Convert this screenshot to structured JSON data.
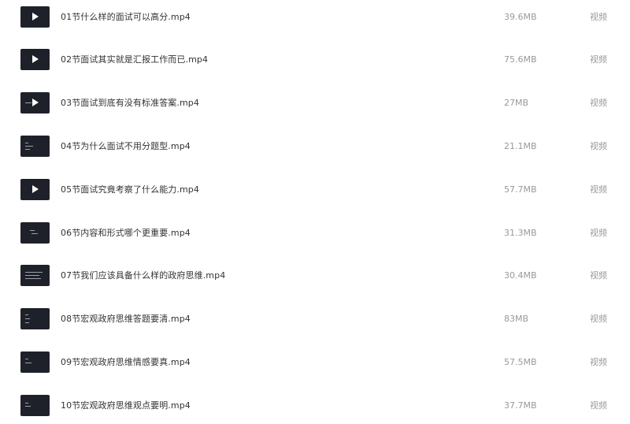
{
  "colors": {
    "thumbnail_bg": "#1e2129",
    "name_text": "#333333",
    "meta_text": "#999999"
  },
  "files": [
    {
      "name": "01节什么样的面试可以高分.mp4",
      "size": "39.6MB",
      "type": "视频",
      "thumb_icon": "play-icon"
    },
    {
      "name": "02节面试其实就是汇报工作而已.mp4",
      "size": "75.6MB",
      "type": "视频",
      "thumb_icon": "play-icon"
    },
    {
      "name": "03节面试到底有没有标准答案.mp4",
      "size": "27MB",
      "type": "视频",
      "thumb_icon": "play-icon"
    },
    {
      "name": "04节为什么面试不用分题型.mp4",
      "size": "21.1MB",
      "type": "视频",
      "thumb_icon": "play-icon"
    },
    {
      "name": "05节面试究竟考察了什么能力.mp4",
      "size": "57.7MB",
      "type": "视频",
      "thumb_icon": "play-icon"
    },
    {
      "name": "06节内容和形式哪个更重要.mp4",
      "size": "31.3MB",
      "type": "视频",
      "thumb_icon": "play-icon"
    },
    {
      "name": "07节我们应该具备什么样的政府思维.mp4",
      "size": "30.4MB",
      "type": "视频",
      "thumb_icon": "play-icon"
    },
    {
      "name": "08节宏观政府思维答题要清.mp4",
      "size": "83MB",
      "type": "视频",
      "thumb_icon": "play-icon"
    },
    {
      "name": "09节宏观政府思维情感要真.mp4",
      "size": "57.5MB",
      "type": "视频",
      "thumb_icon": "play-icon"
    },
    {
      "name": "10节宏观政府思维观点要明.mp4",
      "size": "37.7MB",
      "type": "视频",
      "thumb_icon": "play-icon"
    }
  ]
}
